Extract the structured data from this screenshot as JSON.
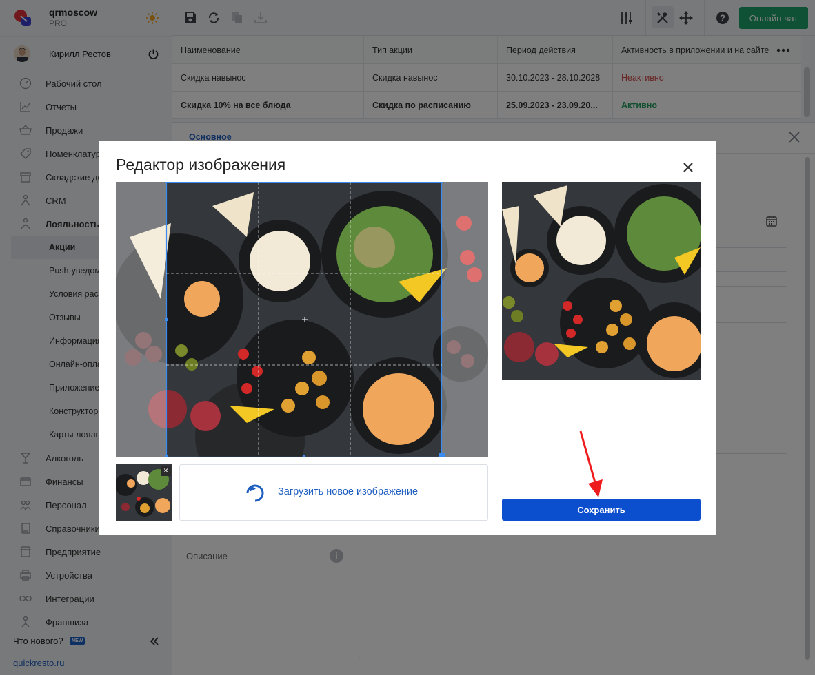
{
  "brand": {
    "name": "qrmoscow",
    "plan": "PRO"
  },
  "user": {
    "name": "Кирилл Рестов"
  },
  "nav": {
    "items": [
      {
        "label": "Рабочий стол",
        "icon": "gauge-icon"
      },
      {
        "label": "Отчеты",
        "icon": "chart-icon"
      },
      {
        "label": "Продажи",
        "icon": "basket-icon"
      },
      {
        "label": "Номенклатура",
        "icon": "tag-icon"
      },
      {
        "label": "Складские документы",
        "icon": "warehouse-icon"
      },
      {
        "label": "CRM",
        "icon": "people-icon"
      },
      {
        "label": "Лояльность",
        "icon": "loyalty-icon"
      }
    ],
    "sub_items": [
      "Акции",
      "Push-уведомления",
      "Условия рассылки",
      "Отзывы",
      "Информация",
      "Онлайн-оплата",
      "Приложение",
      "Конструктор",
      "Карты лояльности"
    ],
    "items_bottom": [
      {
        "label": "Алкоголь",
        "icon": "glass-icon"
      },
      {
        "label": "Финансы",
        "icon": "wallet-icon"
      },
      {
        "label": "Персонал",
        "icon": "staff-icon"
      },
      {
        "label": "Справочники",
        "icon": "book-icon"
      },
      {
        "label": "Предприятие",
        "icon": "store-icon"
      },
      {
        "label": "Устройства",
        "icon": "printer-icon"
      },
      {
        "label": "Интеграции",
        "icon": "infinity-icon"
      },
      {
        "label": "Франшиза",
        "icon": "network-icon"
      }
    ]
  },
  "footer": {
    "whats_new": "Что нового?",
    "new_badge": "NEW",
    "site": "quickresto.ru"
  },
  "topbar": {
    "chat_label": "Онлайн-чат"
  },
  "table": {
    "columns": [
      "Наименование",
      "Тип акции",
      "Период действия",
      "Активность в приложении и на сайте"
    ],
    "rows": [
      {
        "name": "Скидка навынос",
        "type": "Скидка навынос",
        "period": "30.10.2023 - 28.10.2028",
        "status": "Неактивно"
      },
      {
        "name": "Скидка 10% на все блюда",
        "type": "Скидка по расписанию",
        "period": "25.09.2023 - 23.09.20...",
        "status": "Активно"
      }
    ]
  },
  "panel": {
    "tab_main": "Основное",
    "description_label": "Описание",
    "info": "i"
  },
  "modal": {
    "title": "Редактор изображения",
    "upload_label": "Загрузить новое изображение",
    "save_label": "Сохранить",
    "thumb_remove": "×"
  },
  "colors": {
    "accent": "#0b4fce",
    "chat": "#1fa36a",
    "inactive": "#d24848",
    "active": "#1e9e5c",
    "link": "#1f5fc0"
  }
}
